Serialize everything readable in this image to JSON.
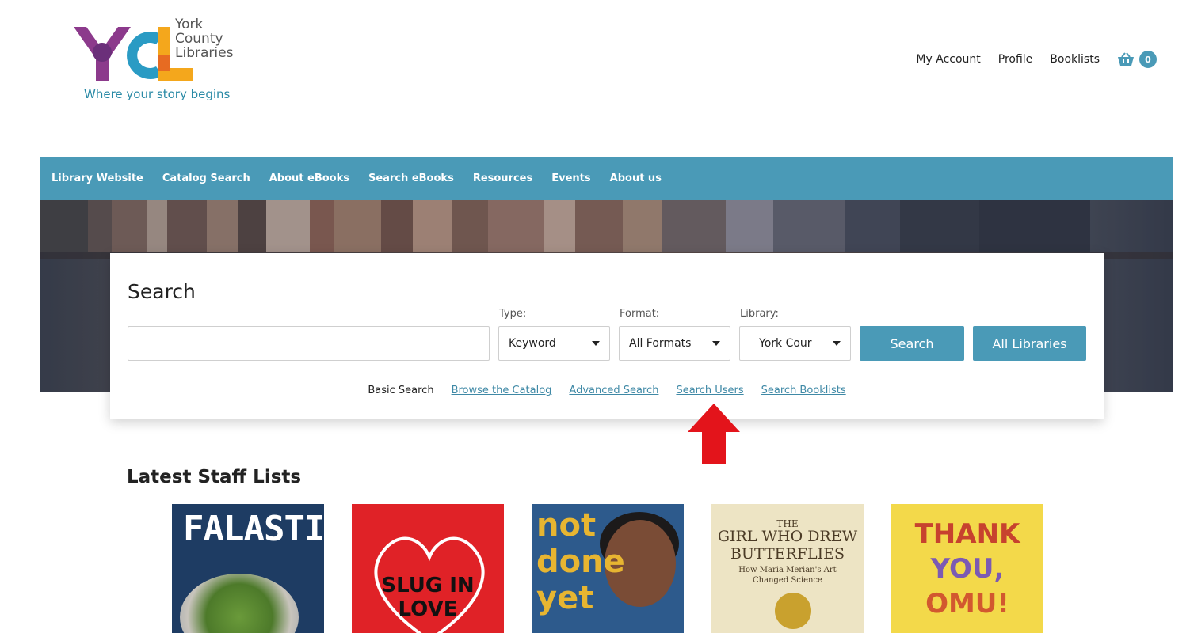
{
  "header": {
    "logo_lines": [
      "York",
      "County",
      "Libraries"
    ],
    "logo_mark": "YCL",
    "tagline": "Where your story begins",
    "links": {
      "my_account": "My Account",
      "profile": "Profile",
      "booklists": "Booklists"
    },
    "cart_icon": "basket-icon",
    "cart_count": "0"
  },
  "nav": {
    "items": [
      "Library Website",
      "Catalog Search",
      "About eBooks",
      "Search eBooks",
      "Resources",
      "Events",
      "About us"
    ]
  },
  "search": {
    "title": "Search",
    "query_value": "",
    "type": {
      "label": "Type:",
      "value": "Keyword"
    },
    "format": {
      "label": "Format:",
      "value": "All Formats"
    },
    "library": {
      "label": "Library:",
      "value": "York Cour"
    },
    "search_button": "Search",
    "all_libraries_button": "All Libraries",
    "links": {
      "basic": "Basic Search",
      "browse": "Browse the Catalog",
      "advanced": "Advanced Search",
      "users": "Search Users",
      "booklists": "Search Booklists"
    }
  },
  "staff_lists": {
    "title": "Latest Staff Lists",
    "covers": [
      {
        "title": "FALASTIN"
      },
      {
        "title_line1": "SLUG IN",
        "title_line2": "LOVE"
      },
      {
        "line1": "not",
        "line2": "done",
        "line3": "yet"
      },
      {
        "line1": "THE",
        "line2": "GIRL WHO DREW",
        "line3": "BUTTERFLIES",
        "line4": "How Maria Merian's Art",
        "line5": "Changed Science"
      },
      {
        "line1": "THANK",
        "line2": "YOU,",
        "line3": "OMU!"
      }
    ]
  },
  "colors": {
    "accent": "#4a9ab7",
    "link": "#3f89a6",
    "annotation_arrow": "#e3141b"
  }
}
